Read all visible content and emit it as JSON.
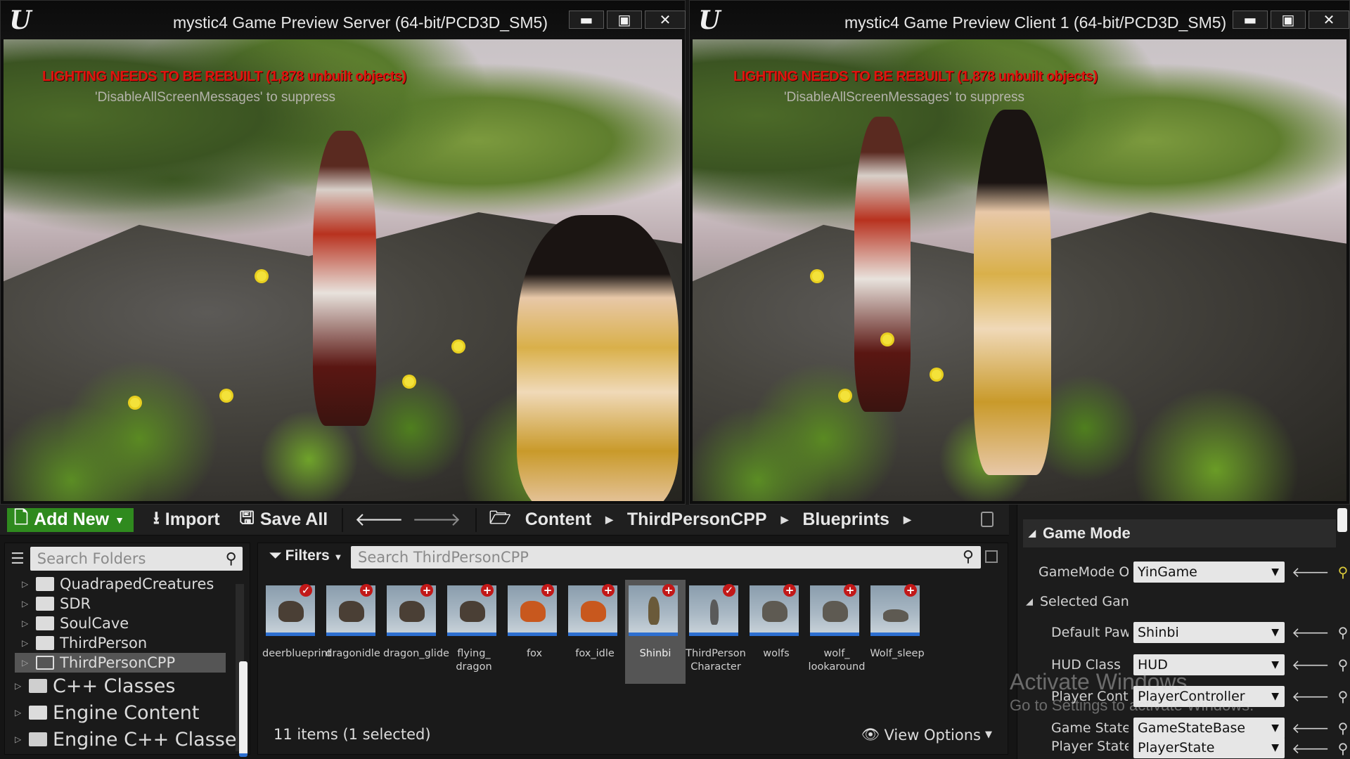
{
  "windows": {
    "server": {
      "title": "mystic4 Game Preview Server (64-bit/PCD3D_SM5)",
      "warning": "LIGHTING NEEDS TO BE REBUILT (1,878 unbuilt objects)",
      "suppress": "'DisableAllScreenMessages' to suppress",
      "logo": "U"
    },
    "client": {
      "title": "mystic4 Game Preview Client 1 (64-bit/PCD3D_SM5)",
      "warning": "LIGHTING NEEDS TO BE REBUILT (1,878 unbuilt objects)",
      "suppress": "'DisableAllScreenMessages' to suppress",
      "logo": "U"
    },
    "controls": {
      "minimize": "▬",
      "maximize": "▣",
      "close": "✕"
    }
  },
  "toolbar": {
    "add_new": "Add New",
    "import": "Import",
    "save_all": "Save All",
    "breadcrumb": [
      "Content",
      "ThirdPersonCPP",
      "Blueprints"
    ]
  },
  "folders": {
    "search_placeholder": "Search Folders",
    "items": [
      {
        "label": "QuadrapedCreatures",
        "type": "folder"
      },
      {
        "label": "SDR",
        "type": "folder"
      },
      {
        "label": "SoulCave",
        "type": "folder"
      },
      {
        "label": "ThirdPerson",
        "type": "folder"
      },
      {
        "label": "ThirdPersonCPP",
        "type": "folder",
        "selected": true
      },
      {
        "label": "C++ Classes",
        "type": "cpp"
      },
      {
        "label": "Engine Content",
        "type": "folder"
      },
      {
        "label": "Engine C++ Classes",
        "type": "cpp"
      }
    ]
  },
  "assets": {
    "filters_label": "Filters",
    "search_placeholder": "Search ThirdPersonCPP",
    "items": [
      {
        "label": "deerblueprint",
        "badge": "check"
      },
      {
        "label": "dragonidle",
        "badge": "plus"
      },
      {
        "label": "dragon_glide",
        "badge": "plus"
      },
      {
        "label": "flying_ dragon",
        "badge": "plus"
      },
      {
        "label": "fox",
        "badge": "plus"
      },
      {
        "label": "fox_idle",
        "badge": "plus"
      },
      {
        "label": "Shinbi",
        "badge": "plus",
        "selected": true
      },
      {
        "label": "ThirdPerson Character",
        "badge": "check"
      },
      {
        "label": "wolfs",
        "badge": "plus"
      },
      {
        "label": "wolf_ lookaround",
        "badge": "plus"
      },
      {
        "label": "Wolf_sleep",
        "badge": "plus"
      }
    ],
    "count_text": "11 items (1 selected)",
    "view_options": "View Options"
  },
  "details": {
    "category": "Game Mode",
    "rows": [
      {
        "label": "GameMode O",
        "value": "YinGame",
        "indent": 1
      },
      {
        "label": "Selected Gan",
        "value": null,
        "indent": 1
      },
      {
        "label": "Default Paw",
        "value": "Shinbi",
        "indent": 2
      },
      {
        "label": "HUD Class",
        "value": "HUD",
        "indent": 2
      },
      {
        "label": "Player Cont",
        "value": "PlayerController",
        "indent": 2
      },
      {
        "label": "Game State",
        "value": "GameStateBase",
        "indent": 2
      },
      {
        "label": "Player State",
        "value": "PlayerState",
        "indent": 2
      }
    ]
  },
  "watermark": {
    "line1": "Activate Windows",
    "line2": "Go to Settings to activate Windows."
  }
}
